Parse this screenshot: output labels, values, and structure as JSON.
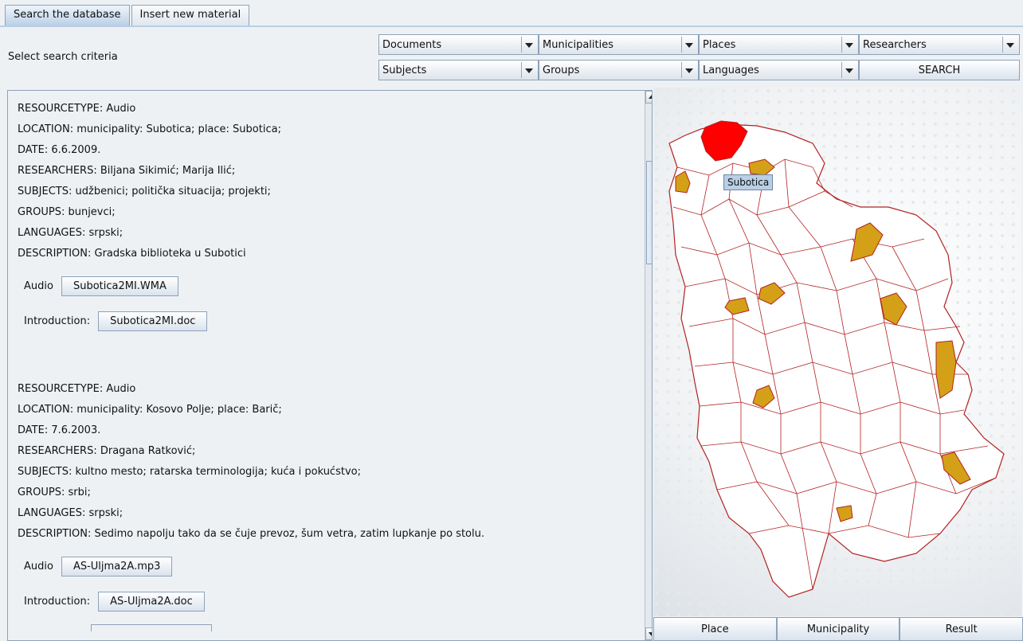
{
  "tabs": [
    {
      "label": "Search the database",
      "active": true
    },
    {
      "label": "Insert new material",
      "active": false
    }
  ],
  "criteria_label": "Select search criteria",
  "filters": {
    "documents": "Documents",
    "municipalities": "Municipalities",
    "places": "Places",
    "researchers": "Researchers",
    "subjects": "Subjects",
    "groups": "Groups",
    "languages": "Languages",
    "search_button": "SEARCH"
  },
  "records": [
    {
      "resourcetype": "RESOURCETYPE: Audio",
      "location": "LOCATION: municipality: Subotica; place: Subotica;",
      "date": "DATE: 6.6.2009.",
      "researchers": "RESEARCHERS: Biljana Sikimić; Marija Ilić;",
      "subjects": "SUBJECTS: udžbenici; politička situacija; projekti;",
      "groups": "GROUPS: bunjevci;",
      "languages": "LANGUAGES: srpski;",
      "description": "DESCRIPTION: Gradska biblioteka u Subotici",
      "audio_label": "Audio",
      "audio_file": "Subotica2MI.WMA",
      "intro_label": "Introduction:",
      "intro_file": "Subotica2MI.doc"
    },
    {
      "resourcetype": "RESOURCETYPE: Audio",
      "location": "LOCATION: municipality: Kosovo Polje; place: Barič;",
      "date": "DATE: 7.6.2003.",
      "researchers": "RESEARCHERS: Dragana Ratković;",
      "subjects": "SUBJECTS: kultno mesto; ratarska terminologija; kuća i pokućstvo;",
      "groups": "GROUPS: srbi;",
      "languages": "LANGUAGES: srpski;",
      "description": "DESCRIPTION: Sedimo napolju tako da se čuje prevoz, šum vetra, zatim lupkanje po stolu.",
      "audio_label": "Audio",
      "audio_file": "AS-Uljma2A.mp3",
      "intro_label": "Introduction:",
      "intro_file": "AS-Uljma2A.doc"
    }
  ],
  "map": {
    "tooltip": "Subotica",
    "selected_color": "#ff0000",
    "highlight_color": "#d4a017",
    "border_color": "#b22222"
  },
  "map_buttons": {
    "place": "Place",
    "municipality": "Municipality",
    "result": "Result"
  }
}
